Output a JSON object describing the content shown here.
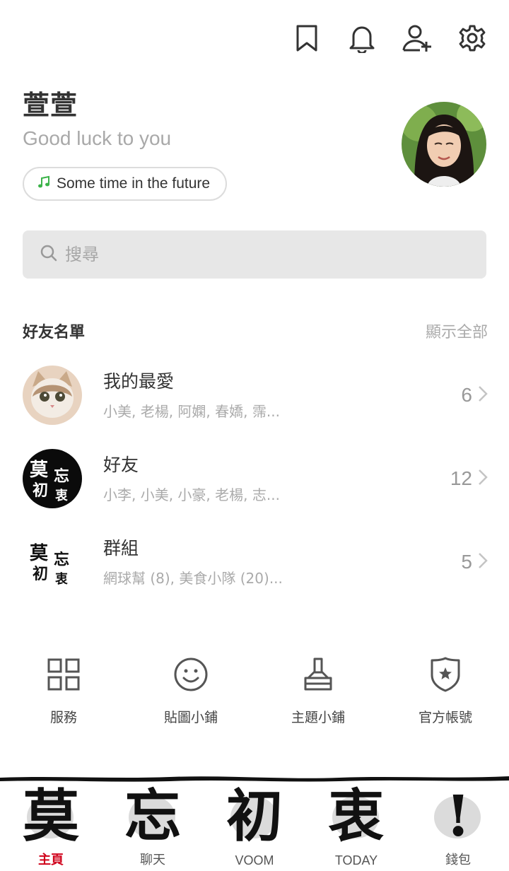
{
  "topbar": {
    "icons": [
      "bookmark-icon",
      "bell-icon",
      "add-friend-icon",
      "settings-icon"
    ]
  },
  "profile": {
    "name": "萱萱",
    "status": "Good luck to you",
    "music": "Some time in the future"
  },
  "search": {
    "placeholder": "搜尋"
  },
  "friends_section": {
    "title": "好友名單",
    "show_all": "顯示全部",
    "rows": [
      {
        "title": "我的最愛",
        "subtitle": "小美, 老楊, 阿嫻, 春嬌, 霈...",
        "count": "6"
      },
      {
        "title": "好友",
        "subtitle": "小李, 小美, 小豪, 老楊, 志...",
        "count": "12"
      },
      {
        "title": "群組",
        "subtitle": "網球幫 (8), 美食小隊 (20)...",
        "count": "5"
      }
    ]
  },
  "services": [
    {
      "label": "服務",
      "icon": "grid-icon"
    },
    {
      "label": "貼圖小鋪",
      "icon": "smiley-icon"
    },
    {
      "label": "主題小鋪",
      "icon": "brush-icon"
    },
    {
      "label": "官方帳號",
      "icon": "shield-star-icon"
    }
  ],
  "tabs": [
    {
      "glyph": "莫",
      "label": "主頁",
      "active": true
    },
    {
      "glyph": "忘",
      "label": "聊天",
      "active": false
    },
    {
      "glyph": "初",
      "label": "VOOM",
      "active": false
    },
    {
      "glyph": "衷",
      "label": "TODAY",
      "active": false
    },
    {
      "glyph": "!",
      "label": "錢包",
      "active": false
    }
  ],
  "colors": {
    "accent_active_tab": "#d0021b",
    "music_note": "#3cb34a",
    "search_bg": "#e7e7e7"
  }
}
